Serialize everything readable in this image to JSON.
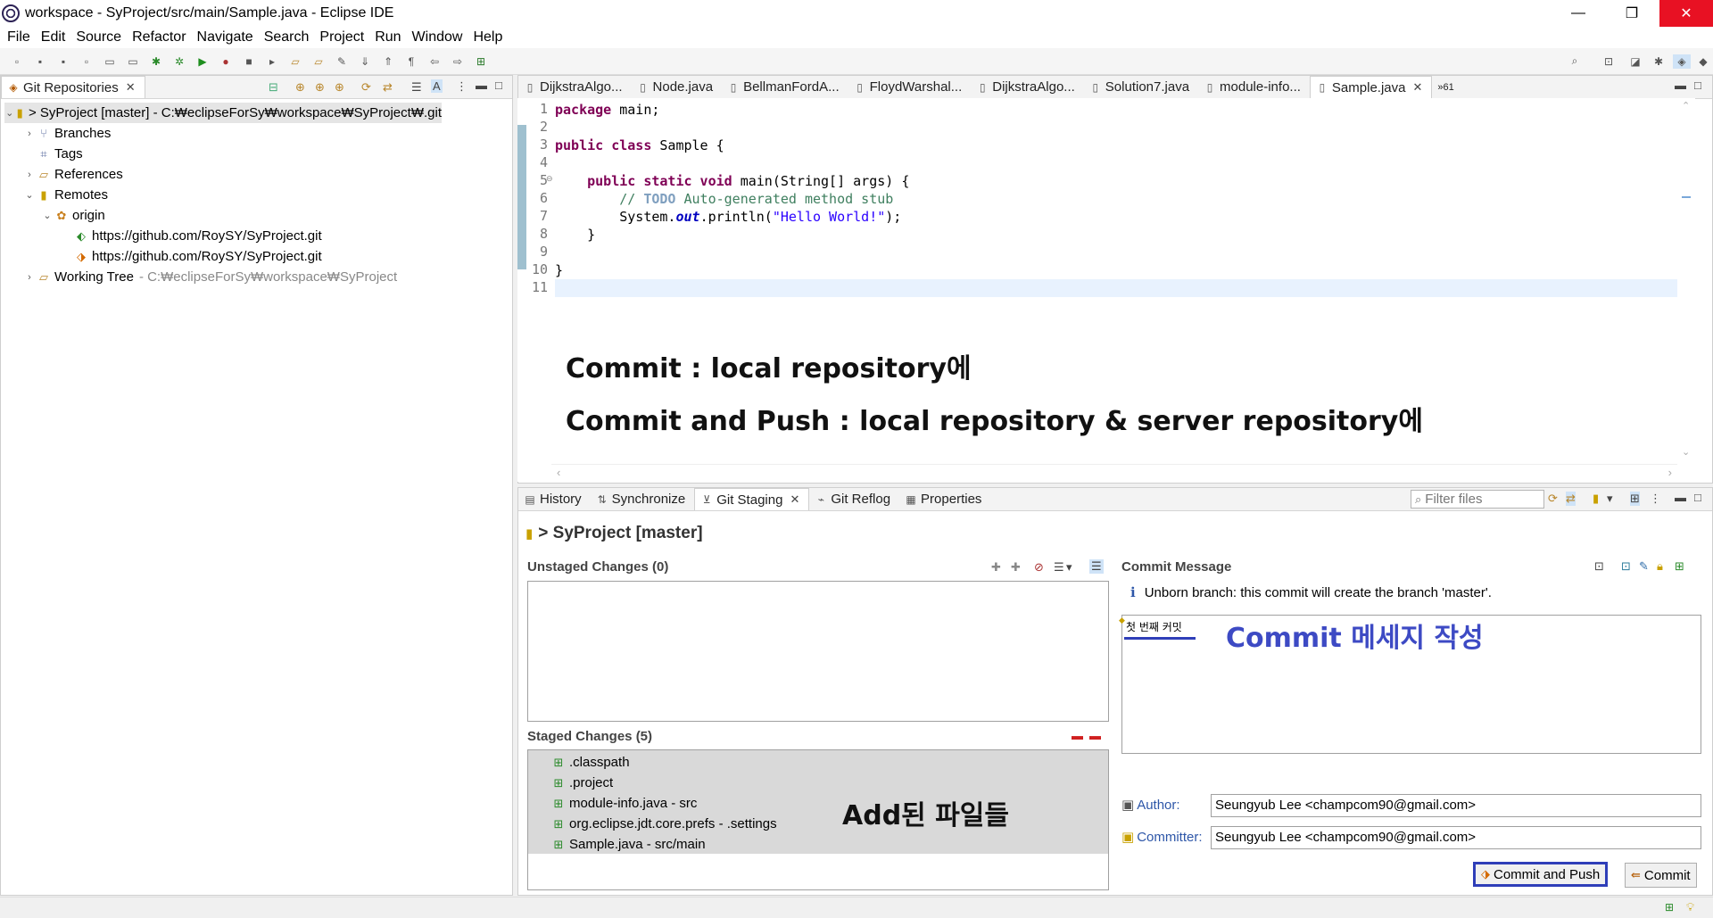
{
  "window": {
    "title": "workspace - SyProject/src/main/Sample.java - Eclipse IDE",
    "minimize": "—",
    "restore": "❐",
    "close": "✕"
  },
  "menu": [
    "File",
    "Edit",
    "Source",
    "Refactor",
    "Navigate",
    "Search",
    "Project",
    "Run",
    "Window",
    "Help"
  ],
  "git_repositories": {
    "tab_label": "Git Repositories",
    "repo": "> SyProject [master] - C:₩eclipseForSy₩workspace₩SyProject₩.git",
    "items": {
      "branches": "Branches",
      "tags": "Tags",
      "references": "References",
      "remotes": "Remotes",
      "origin": "origin",
      "fetch_url": "https://github.com/RoySY/SyProject.git",
      "push_url": "https://github.com/RoySY/SyProject.git",
      "working_tree": "Working Tree",
      "working_tree_path": "- C:₩eclipseForSy₩workspace₩SyProject"
    }
  },
  "editor_tabs": [
    "DijkstraAlgo...",
    "Node.java",
    "BellmanFordA...",
    "FloydWarshal...",
    "DijkstraAlgo...",
    "Solution7.java",
    "module-info...",
    "Sample.java"
  ],
  "editor_tabs_overflow": "»61",
  "code": {
    "line_numbers": [
      "1",
      "2",
      "3",
      "4",
      "5",
      "6",
      "7",
      "8",
      "9",
      "10",
      "11"
    ],
    "fold_marker": "⊖",
    "l1_kw": "package",
    "l1_rest": " main;",
    "l3_kw": "public class",
    "l3_rest": " Sample {",
    "l5_kw": "public static void",
    "l5_rest": " main(String[] args) {",
    "l6_slashes": "// ",
    "l6_todo": "TODO",
    "l6_rest": " Auto-generated method stub",
    "l7_a": "System.",
    "l7_out": "out",
    "l7_b": ".println(",
    "l7_str": "\"Hello World!\"",
    "l7_c": ");",
    "l8": "    }",
    "l10": "}"
  },
  "annotations": {
    "commit": "Commit : local repository에",
    "commit_push": "Commit and Push : local repository & server repository에",
    "commit_msg": "Commit 메세지 작성",
    "added_files": "Add된 파일들"
  },
  "bottom_tabs": [
    "History",
    "Synchronize",
    "Git Staging",
    "Git Reflog",
    "Properties"
  ],
  "filter_placeholder": "Filter files",
  "staging": {
    "repo_title": "> SyProject [master]",
    "unstaged_header": "Unstaged Changes (0)",
    "staged_header": "Staged Changes (5)",
    "staged_files": [
      ".classpath",
      ".project",
      "module-info.java - src",
      "org.eclipse.jdt.core.prefs - .settings",
      "Sample.java - src/main"
    ],
    "commit_message_header": "Commit Message",
    "info": "Unborn branch: this commit will create the branch 'master'.",
    "message_text": "첫 번째 커밋",
    "author_label": "Author:",
    "author_value": "Seungyub Lee <champcom90@gmail.com>",
    "committer_label": "Committer:",
    "committer_value": "Seungyub Lee <champcom90@gmail.com>",
    "commit_and_push": "Commit and Push",
    "commit": "Commit"
  },
  "colors": {
    "annotation_blue": "#2f3eb8",
    "keyword": "#7f0055",
    "comment": "#3f7f5f",
    "string": "#2a00ff",
    "selection_gray": "#d9d9d9"
  }
}
